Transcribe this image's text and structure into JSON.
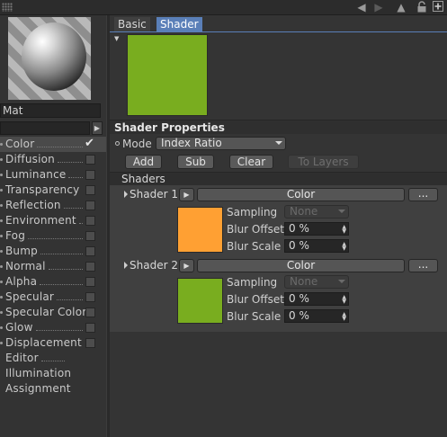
{
  "topbar": {
    "icons": [
      "back-arrow-icon",
      "forward-arrow-icon",
      "up-arrow-icon",
      "lock-icon",
      "new-window-icon"
    ]
  },
  "material": {
    "name": "Mat"
  },
  "channels": [
    {
      "label": "Color",
      "checked": true,
      "active": true
    },
    {
      "label": "Diffusion",
      "checked": false
    },
    {
      "label": "Luminance",
      "checked": false
    },
    {
      "label": "Transparency",
      "checked": false
    },
    {
      "label": "Reflection",
      "checked": false
    },
    {
      "label": "Environment",
      "checked": false
    },
    {
      "label": "Fog",
      "checked": false
    },
    {
      "label": "Bump",
      "checked": false
    },
    {
      "label": "Normal",
      "checked": false
    },
    {
      "label": "Alpha",
      "checked": false
    },
    {
      "label": "Specular",
      "checked": false
    },
    {
      "label": "Specular Color",
      "checked": false
    },
    {
      "label": "Glow",
      "checked": false
    },
    {
      "label": "Displacement",
      "checked": false
    },
    {
      "label": "Editor"
    },
    {
      "label": "Illumination"
    },
    {
      "label": "Assignment"
    }
  ],
  "tabs": [
    {
      "label": "Basic",
      "active": false
    },
    {
      "label": "Shader",
      "active": true
    }
  ],
  "colors": {
    "preview": "#79ad1f",
    "shader1": "#ffa033",
    "shader2": "#79ad1f",
    "accent": "#5a7fb8"
  },
  "shader_properties": {
    "title": "Shader Properties",
    "mode_label": "Mode",
    "mode_value": "Index Ratio",
    "buttons": {
      "add": "Add",
      "sub": "Sub",
      "clear": "Clear",
      "to_layers": "To Layers"
    }
  },
  "shaders": {
    "title": "Shaders",
    "items": [
      {
        "label": "Shader 1",
        "type": "Color",
        "more": "...",
        "sampling_label": "Sampling",
        "sampling_value": "None",
        "blur_offset_label": "Blur Offset",
        "blur_offset_value": "0 %",
        "blur_scale_label": "Blur Scale",
        "blur_scale_value": "0 %"
      },
      {
        "label": "Shader 2",
        "type": "Color",
        "more": "...",
        "sampling_label": "Sampling",
        "sampling_value": "None",
        "blur_offset_label": "Blur Offset",
        "blur_offset_value": "0 %",
        "blur_scale_label": "Blur Scale",
        "blur_scale_value": "0 %"
      }
    ]
  }
}
